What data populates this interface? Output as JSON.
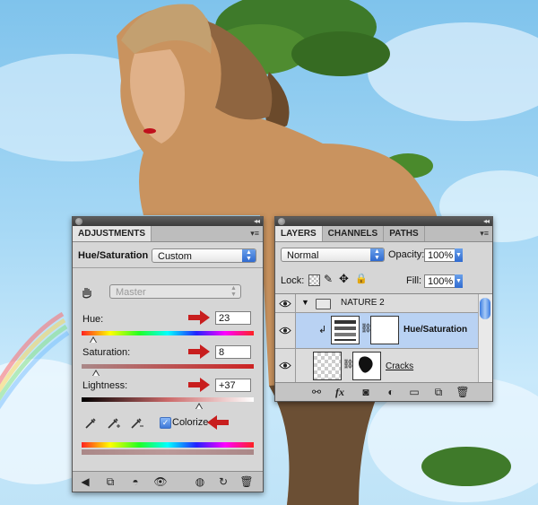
{
  "adjustments_panel": {
    "tab": "ADJUSTMENTS",
    "adjustment_name": "Hue/Saturation",
    "preset": "Custom",
    "channel": "Master",
    "hue_label": "Hue:",
    "hue_value": "23",
    "saturation_label": "Saturation:",
    "saturation_value": "8",
    "lightness_label": "Lightness:",
    "lightness_value": "+37",
    "colorize_label": "Colorize",
    "colorize_checked": true,
    "icons": [
      "hand-adjust-icon",
      "eyedropper-icon",
      "eyedropper-plus-icon",
      "eyedropper-minus-icon",
      "back-arrow-icon",
      "panel-view-icon",
      "clip-layer-icon",
      "visibility-eye-icon",
      "previous-state-icon",
      "reset-icon",
      "trash-icon"
    ]
  },
  "layers_panel": {
    "tabs": [
      "LAYERS",
      "CHANNELS",
      "PATHS"
    ],
    "blend_mode": "Normal",
    "opacity_label": "Opacity:",
    "opacity_value": "100%",
    "lock_label": "Lock:",
    "fill_label": "Fill:",
    "fill_value": "100%",
    "group_name": "NATURE 2",
    "layer_1_name": "Hue/Saturation",
    "layer_2_name": "Cracks",
    "icons": [
      "link-icon",
      "fx-icon",
      "mask-icon",
      "adjustment-layer-icon",
      "folder-icon",
      "new-layer-icon",
      "trash-icon"
    ]
  },
  "colors": {
    "accent_red": "#c81e1e",
    "selection_blue": "#b9d2f3",
    "panel_gray": "#d6d6d6"
  }
}
